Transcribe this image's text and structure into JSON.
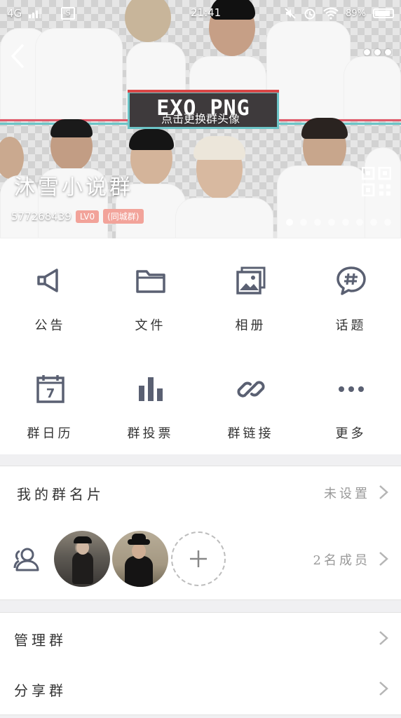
{
  "status_bar": {
    "network": "4G",
    "time": "21:41",
    "battery": "89%"
  },
  "header": {
    "logo_text": "EXO PNG",
    "logo_subtitle": "点击更换群头像",
    "group_name": "沐雪小说群",
    "group_id": "577268439",
    "level_badge": "LV0",
    "city_badge": "(同城群)",
    "page_count": 8,
    "active_page": 0
  },
  "grid": {
    "items": [
      {
        "label": "公告",
        "icon": "megaphone-icon"
      },
      {
        "label": "文件",
        "icon": "folder-icon"
      },
      {
        "label": "相册",
        "icon": "photo-album-icon"
      },
      {
        "label": "话题",
        "icon": "topic-hash-icon"
      },
      {
        "label": "群日历",
        "icon": "calendar-icon"
      },
      {
        "label": "群投票",
        "icon": "bar-chart-icon"
      },
      {
        "label": "群链接",
        "icon": "link-icon"
      },
      {
        "label": "更多",
        "icon": "more-dots-icon"
      }
    ],
    "calendar_day": "7"
  },
  "my_card": {
    "label": "我的群名片",
    "value": "未设置"
  },
  "members": {
    "count_text": "2名成员"
  },
  "manage": {
    "label": "管理群"
  },
  "share": {
    "label": "分享群"
  },
  "colors": {
    "icon": "#5a6072",
    "banner_accent": "#6cc4c7",
    "badge": "#f2a39a"
  }
}
